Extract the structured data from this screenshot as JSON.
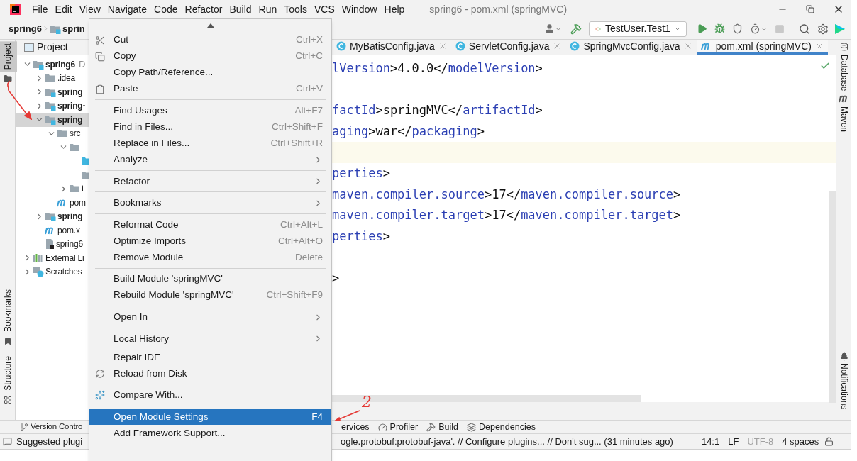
{
  "title_bar": {
    "menu": [
      "File",
      "Edit",
      "View",
      "Navigate",
      "Code",
      "Refactor",
      "Build",
      "Run",
      "Tools",
      "VCS",
      "Window",
      "Help"
    ],
    "title": "spring6 - pom.xml (springMVC)"
  },
  "nav_bar": {
    "breadcrumbs": [
      "spring6",
      "sprin"
    ],
    "run_config": "TestUser.Test1"
  },
  "left_stripe": [
    {
      "label": "Project",
      "selected": true
    },
    {
      "label": "Bookmarks",
      "selected": false
    },
    {
      "label": "Structure",
      "selected": false
    }
  ],
  "project_panel": {
    "title": "Project",
    "tree": [
      {
        "label": "spring6",
        "hint": "D",
        "kind": "module",
        "expanded": true,
        "selected": false,
        "children": [
          {
            "label": ".idea",
            "kind": "folder",
            "expanded": false,
            "selected": false
          },
          {
            "label": "spring",
            "kind": "module",
            "expanded": false,
            "selected": false
          },
          {
            "label": "spring-",
            "kind": "module",
            "expanded": false,
            "selected": false
          },
          {
            "label": "spring",
            "kind": "module",
            "expanded": true,
            "selected": true,
            "children": [
              {
                "label": "src",
                "kind": "folder",
                "expanded": true,
                "selected": false,
                "children": [
                  {
                    "kind": "folder",
                    "expanded": true,
                    "selected": false,
                    "children": [
                      {
                        "kind": "source",
                        "selected": false
                      },
                      {
                        "kind": "folder",
                        "selected": false
                      }
                    ]
                  },
                  {
                    "label": "t",
                    "kind": "folder",
                    "expanded": false,
                    "selected": false
                  }
                ]
              },
              {
                "label": "pom",
                "kind": "maven",
                "selected": false
              }
            ]
          },
          {
            "label": "spring",
            "kind": "module",
            "expanded": false,
            "selected": false
          },
          {
            "label": "pom.x",
            "kind": "maven",
            "selected": false
          },
          {
            "label": "spring6",
            "kind": "file",
            "selected": false
          }
        ]
      },
      {
        "label": "External Li",
        "kind": "library",
        "expanded": false,
        "selected": false
      },
      {
        "label": "Scratches",
        "kind": "scratches",
        "expanded": false,
        "selected": false
      }
    ]
  },
  "editor": {
    "tabs": [
      {
        "label": "MyBatisConfig.java",
        "kind": "class",
        "selected": false
      },
      {
        "label": "ServletConfig.java",
        "kind": "class",
        "selected": false
      },
      {
        "label": "SpringMvcConfig.java",
        "kind": "class",
        "selected": false
      },
      {
        "label": "pom.xml (springMVC)",
        "kind": "maven",
        "selected": true
      }
    ],
    "lines": [
      {
        "current": false,
        "segments": [
          {
            "text": "lVersion",
            "kind": "tag"
          },
          {
            "text": ">4.0.0</",
            "kind": "plain"
          },
          {
            "text": "modelVersion",
            "kind": "tag"
          },
          {
            "text": ">",
            "kind": "plain"
          }
        ]
      },
      {
        "current": false
      },
      {
        "current": false,
        "segments": [
          {
            "text": "factId",
            "kind": "tag"
          },
          {
            "text": ">springMVC</",
            "kind": "plain"
          },
          {
            "text": "artifactId",
            "kind": "tag"
          },
          {
            "text": ">",
            "kind": "plain"
          }
        ]
      },
      {
        "current": false,
        "segments": [
          {
            "text": "aging",
            "kind": "tag"
          },
          {
            "text": ">war</",
            "kind": "plain"
          },
          {
            "text": "packaging",
            "kind": "tag"
          },
          {
            "text": ">",
            "kind": "plain"
          }
        ]
      },
      {
        "current": true
      },
      {
        "current": false,
        "segments": [
          {
            "text": "perties",
            "kind": "tag"
          },
          {
            "text": ">",
            "kind": "plain"
          }
        ]
      },
      {
        "current": false,
        "segments": [
          {
            "text": "maven.compiler.source",
            "kind": "tag"
          },
          {
            "text": ">17</",
            "kind": "plain"
          },
          {
            "text": "maven.compiler.source",
            "kind": "tag"
          },
          {
            "text": ">",
            "kind": "plain"
          }
        ]
      },
      {
        "current": false,
        "segments": [
          {
            "text": "maven.compiler.target",
            "kind": "tag"
          },
          {
            "text": ">17</",
            "kind": "plain"
          },
          {
            "text": "maven.compiler.target",
            "kind": "tag"
          },
          {
            "text": ">",
            "kind": "plain"
          }
        ]
      },
      {
        "current": false,
        "segments": [
          {
            "text": "perties",
            "kind": "tag"
          },
          {
            "text": ">",
            "kind": "plain"
          }
        ]
      },
      {
        "current": false
      },
      {
        "current": false,
        "segments": [
          {
            "text": ">",
            "kind": "plain"
          }
        ]
      }
    ]
  },
  "right_stripe": [
    "Database",
    "Maven",
    "Notifications"
  ],
  "tool_bar": {
    "left": [
      "Version Contro"
    ],
    "right": [
      "ervices",
      "Profiler",
      "Build",
      "Dependencies"
    ]
  },
  "status_bar": {
    "left_message": "Suggested plugi",
    "message": "ogle.protobuf:protobuf-java'. // Configure plugins... // Don't sug... (31 minutes ago)",
    "position": "14:1",
    "line_separator": "LF",
    "encoding": "UTF-8",
    "indent": "4 spaces"
  },
  "context_menu": {
    "items": [
      {
        "kind": "item",
        "label": "Cut",
        "shortcut": "Ctrl+X",
        "submenu": false,
        "selected": false
      },
      {
        "kind": "item",
        "label": "Copy",
        "shortcut": "Ctrl+C",
        "submenu": false,
        "selected": false
      },
      {
        "kind": "item",
        "label": "Copy Path/Reference...",
        "submenu": false,
        "selected": false
      },
      {
        "kind": "item",
        "label": "Paste",
        "shortcut": "Ctrl+V",
        "submenu": false,
        "selected": false
      },
      {
        "kind": "separator"
      },
      {
        "kind": "item",
        "label": "Find Usages",
        "shortcut": "Alt+F7",
        "submenu": false,
        "selected": false
      },
      {
        "kind": "item",
        "label": "Find in Files...",
        "shortcut": "Ctrl+Shift+F",
        "submenu": false,
        "selected": false
      },
      {
        "kind": "item",
        "label": "Replace in Files...",
        "shortcut": "Ctrl+Shift+R",
        "submenu": false,
        "selected": false
      },
      {
        "kind": "item",
        "label": "Analyze",
        "submenu": true,
        "selected": false
      },
      {
        "kind": "separator"
      },
      {
        "kind": "item",
        "label": "Refactor",
        "submenu": true,
        "selected": false
      },
      {
        "kind": "separator"
      },
      {
        "kind": "item",
        "label": "Bookmarks",
        "submenu": true,
        "selected": false
      },
      {
        "kind": "separator"
      },
      {
        "kind": "item",
        "label": "Reformat Code",
        "shortcut": "Ctrl+Alt+L",
        "submenu": false,
        "selected": false
      },
      {
        "kind": "item",
        "label": "Optimize Imports",
        "shortcut": "Ctrl+Alt+O",
        "submenu": false,
        "selected": false
      },
      {
        "kind": "item",
        "label": "Remove Module",
        "shortcut": "Delete",
        "submenu": false,
        "selected": false
      },
      {
        "kind": "separator"
      },
      {
        "kind": "item",
        "label": "Build Module 'springMVC'",
        "submenu": false,
        "selected": false
      },
      {
        "kind": "item",
        "label": "Rebuild Module 'springMVC'",
        "shortcut": "Ctrl+Shift+F9",
        "submenu": false,
        "selected": false
      },
      {
        "kind": "separator"
      },
      {
        "kind": "item",
        "label": "Open In",
        "submenu": true,
        "selected": false
      },
      {
        "kind": "separator"
      },
      {
        "kind": "item",
        "label": "Local History",
        "submenu": true,
        "selected": false
      },
      {
        "kind": "rule"
      },
      {
        "kind": "item",
        "label": "Repair IDE",
        "submenu": false,
        "selected": false
      },
      {
        "kind": "item",
        "label": "Reload from Disk",
        "submenu": false,
        "selected": false
      },
      {
        "kind": "separator"
      },
      {
        "kind": "item",
        "label": "Compare With...",
        "submenu": false,
        "selected": false
      },
      {
        "kind": "separator"
      },
      {
        "kind": "item",
        "label": "Open Module Settings",
        "shortcut": "F4",
        "submenu": false,
        "selected": true
      },
      {
        "kind": "item",
        "label": "Add Framework Support...",
        "submenu": false,
        "selected": false
      }
    ]
  },
  "annotations": [
    {
      "label": "2"
    }
  ]
}
